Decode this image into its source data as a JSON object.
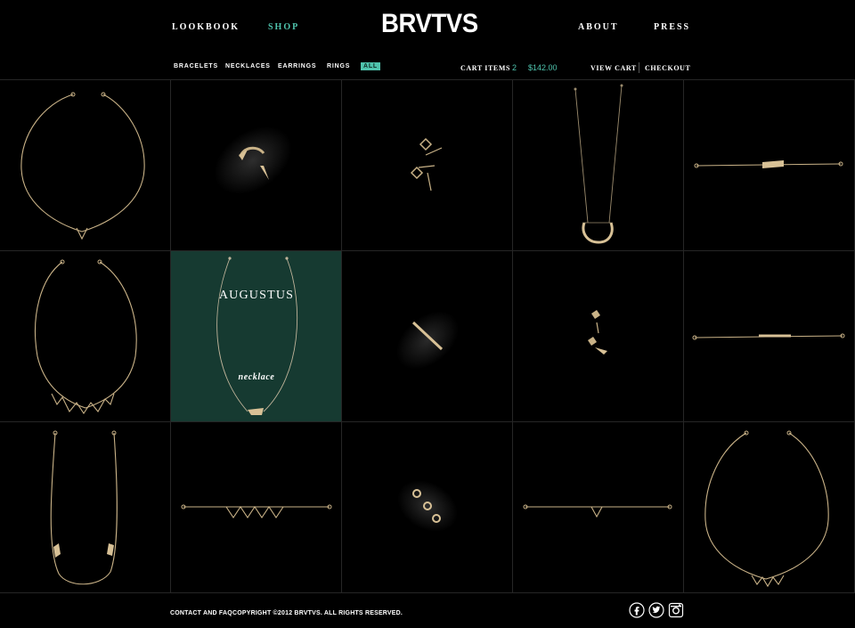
{
  "nav": {
    "lookbook": "LOOKBOOK",
    "shop": "SHOP",
    "brand": "BRVTVS",
    "about": "ABOUT",
    "press": "PRESS"
  },
  "categories": {
    "bracelets": "BRACELETS",
    "necklaces": "NECKLACES",
    "earrings": "EARRINGS",
    "rings": "RINGS",
    "all": "ALL"
  },
  "cart": {
    "label": "CART ITEMS",
    "count": "2",
    "total": "$142.00",
    "view": "VIEW CART",
    "checkout": "CHECKOUT"
  },
  "featured": {
    "name": "AUGUSTUS",
    "type": "necklace"
  },
  "colors": {
    "accent": "#4fc3ad",
    "feature_bg": "#163a31",
    "gold": "#c9b287"
  },
  "footer": {
    "contact": "CONTACT AND FAQ",
    "copyright": "COPYRIGHT ©2012 BRVTVS. ALL RIGHTS RESERVED."
  },
  "social": [
    "facebook-icon",
    "twitter-icon",
    "instagram-icon"
  ]
}
